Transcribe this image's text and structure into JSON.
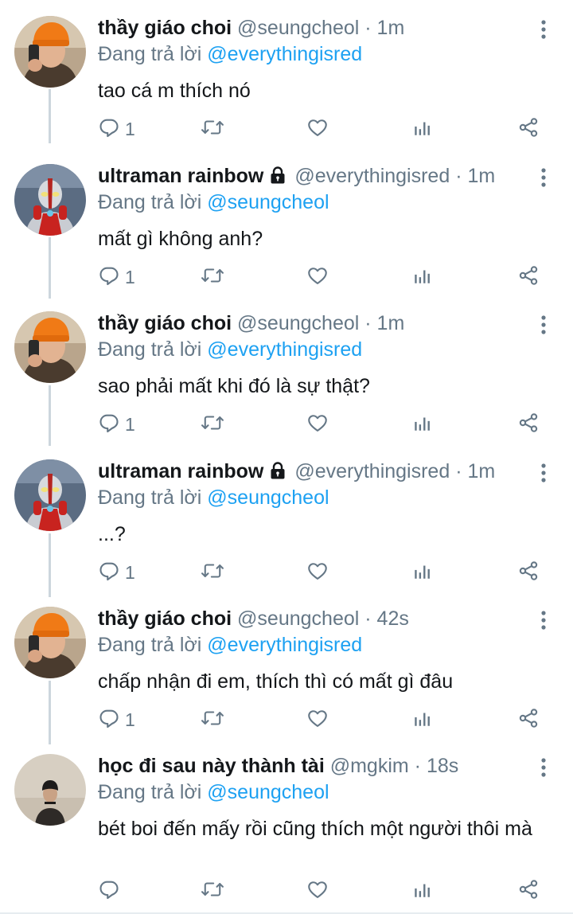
{
  "thread": {
    "tweets": [
      {
        "name": "thầy giáo choi",
        "handle": "@seungcheol",
        "dot": "·",
        "time": "1m",
        "replying_prefix": "Đang trả lời ",
        "replying_to": "@everythingisred",
        "text": "tao cá m thích nó",
        "reply_count": "1",
        "locked": false,
        "avatar": "avatar-orange-beanie"
      },
      {
        "name": "ultraman rainbow",
        "handle": "@everythingisred",
        "dot": "·",
        "time": "1m",
        "replying_prefix": "Đang trả lời ",
        "replying_to": "@seungcheol",
        "text": "mất gì không anh?",
        "reply_count": "1",
        "locked": true,
        "avatar": "avatar-ultraman"
      },
      {
        "name": "thầy giáo choi",
        "handle": "@seungcheol",
        "dot": "·",
        "time": "1m",
        "replying_prefix": "Đang trả lời ",
        "replying_to": "@everythingisred",
        "text": "sao phải mất khi đó là sự thật?",
        "reply_count": "1",
        "locked": false,
        "avatar": "avatar-orange-beanie"
      },
      {
        "name": "ultraman rainbow",
        "handle": "@everythingisred",
        "dot": "·",
        "time": "1m",
        "replying_prefix": "Đang trả lời ",
        "replying_to": "@seungcheol",
        "text": "...?",
        "reply_count": "1",
        "locked": true,
        "avatar": "avatar-ultraman"
      },
      {
        "name": "thầy giáo choi",
        "handle": "@seungcheol",
        "dot": "·",
        "time": "42s",
        "replying_prefix": "Đang trả lời ",
        "replying_to": "@everythingisred",
        "text": "chấp nhận đi em, thích thì có mất gì đâu",
        "reply_count": "1",
        "locked": false,
        "avatar": "avatar-orange-beanie"
      },
      {
        "name": "học đi sau này thành tài",
        "handle": "@mgkim",
        "dot": "·",
        "time": "18s",
        "replying_prefix": "Đang trả lời ",
        "replying_to": "@seungcheol",
        "text": "bét boi đến mấy rồi cũng thích một người thôi mà",
        "reply_count": "",
        "locked": false,
        "avatar": "avatar-dark-photo"
      }
    ]
  },
  "colors": {
    "text_primary": "#14171a",
    "text_secondary": "#657786",
    "accent": "#1da1f2",
    "thread_line": "#ccd6dd",
    "divider": "#e6ecf0"
  },
  "icons": {
    "reply": "reply-icon",
    "retweet": "retweet-icon",
    "like": "heart-icon",
    "analytics": "analytics-icon",
    "share": "share-icon",
    "more": "more-vertical-icon",
    "protected": "lock-icon"
  }
}
